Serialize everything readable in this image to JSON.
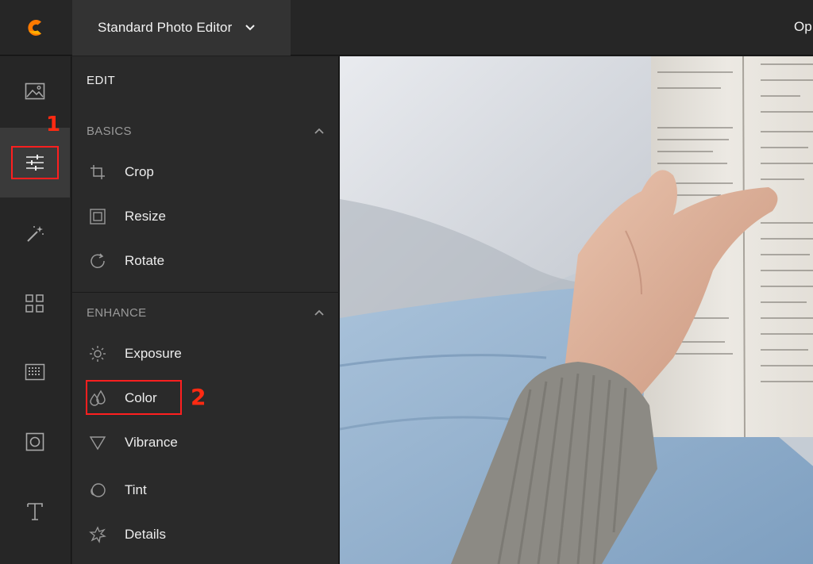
{
  "header": {
    "editor_mode": "Standard Photo Editor",
    "right_text": "Op"
  },
  "rail": {
    "items": [
      {
        "icon": "image-icon"
      },
      {
        "icon": "sliders-icon",
        "active": true
      },
      {
        "icon": "magic-wand-icon"
      },
      {
        "icon": "grid-icon"
      },
      {
        "icon": "texture-icon"
      },
      {
        "icon": "frame-icon"
      },
      {
        "icon": "text-icon"
      }
    ],
    "marker": "1"
  },
  "panel": {
    "title": "EDIT",
    "basics": {
      "title": "BASICS",
      "items": [
        {
          "label": "Crop",
          "icon": "crop-icon"
        },
        {
          "label": "Resize",
          "icon": "resize-icon"
        },
        {
          "label": "Rotate",
          "icon": "rotate-icon"
        }
      ]
    },
    "enhance": {
      "title": "ENHANCE",
      "items": [
        {
          "label": "Exposure",
          "icon": "sun-icon"
        },
        {
          "label": "Color",
          "icon": "color-drops-icon"
        },
        {
          "label": "Vibrance",
          "icon": "triangle-icon"
        },
        {
          "label": "Tint",
          "icon": "tint-icon"
        },
        {
          "label": "Details",
          "icon": "details-icon"
        }
      ]
    },
    "marker": "2"
  },
  "colors": {
    "accent": "#ff6a00",
    "highlight": "#ff1f1f",
    "marker": "#ff2a12"
  }
}
